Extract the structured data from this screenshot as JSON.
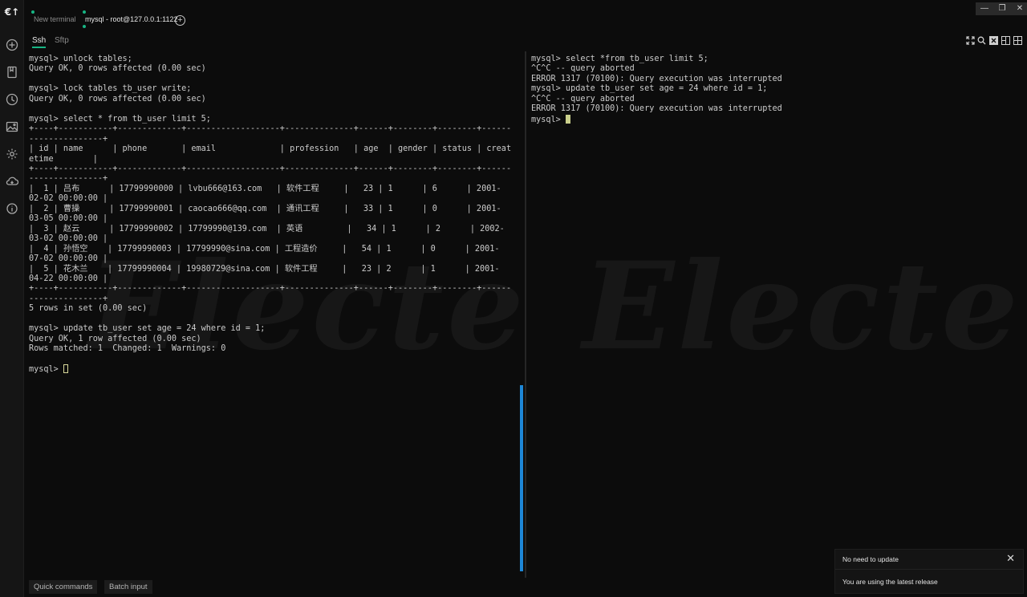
{
  "app": {
    "logo_text": "€↑"
  },
  "tabs": [
    {
      "label": "New terminal",
      "active": false
    },
    {
      "label": "mysql - root@127.0.0.1:1122",
      "active": true
    }
  ],
  "add_tab_symbol": "+",
  "window_controls": [
    "—",
    "❐",
    "✕"
  ],
  "subtabs": [
    {
      "label": "Ssh",
      "active": true
    },
    {
      "label": "Sftp",
      "active": false
    }
  ],
  "rail_icons": [
    "add-circle-icon",
    "bookmark-icon",
    "history-icon",
    "image-icon",
    "gear-icon",
    "cloud-sync-icon",
    "info-icon"
  ],
  "toolbar_icons": [
    "fullscreen-icon",
    "search-icon",
    "close-split-icon",
    "split-vertical-icon",
    "split-grid-icon"
  ],
  "terminal_left": {
    "text": "mysql> unlock tables;\nQuery OK, 0 rows affected (0.00 sec)\n\nmysql> lock tables tb_user write;\nQuery OK, 0 rows affected (0.00 sec)\n\nmysql> select * from tb_user limit 5;\n+----+-----------+-------------+-------------------+--------------+------+--------+--------+------\n---------------+\n| id | name      | phone       | email             | profession   | age  | gender | status | creat\netime        |\n+----+-----------+-------------+-------------------+--------------+------+--------+--------+------\n---------------+\n|  1 | 吕布      | 17799990000 | lvbu666@163.com   | 软件工程     |   23 | 1      | 6      | 2001-\n02-02 00:00:00 |\n|  2 | 曹操      | 17799990001 | caocao666@qq.com  | 通讯工程     |   33 | 1      | 0      | 2001-\n03-05 00:00:00 |\n|  3 | 赵云      | 17799990002 | 17799990@139.com  | 英语         |   34 | 1      | 2      | 2002-\n03-02 00:00:00 |\n|  4 | 孙悟空    | 17799990003 | 17799990@sina.com | 工程造价     |   54 | 1      | 0      | 2001-\n07-02 00:00:00 |\n|  5 | 花木兰    | 17799990004 | 19980729@sina.com | 软件工程     |   23 | 2      | 1      | 2001-\n04-22 00:00:00 |\n+----+-----------+-------------+-------------------+--------------+------+--------+--------+------\n---------------+\n5 rows in set (0.00 sec)\n\nmysql> update tb_user set age = 24 where id = 1;\nQuery OK, 1 row affected (0.00 sec)\nRows matched: 1  Changed: 1  Warnings: 0\n\nmysql> "
  },
  "terminal_right": {
    "text": "mysql> select *from tb_user limit 5;\n^C^C -- query aborted\nERROR 1317 (70100): Query execution was interrupted\nmysql> update tb_user set age = 24 where id = 1;\n^C^C -- query aborted\nERROR 1317 (70100): Query execution was interrupted\nmysql> "
  },
  "watermark_text": "Electerm",
  "bottom_buttons": [
    "Quick commands",
    "Batch input"
  ],
  "notification": {
    "title": "No need to update",
    "message": "You are using the latest release",
    "close_symbol": "✕"
  },
  "colors": {
    "accent": "#17b584",
    "scrollbar": "#1e87d7",
    "cursor": "#c9cf8b"
  }
}
